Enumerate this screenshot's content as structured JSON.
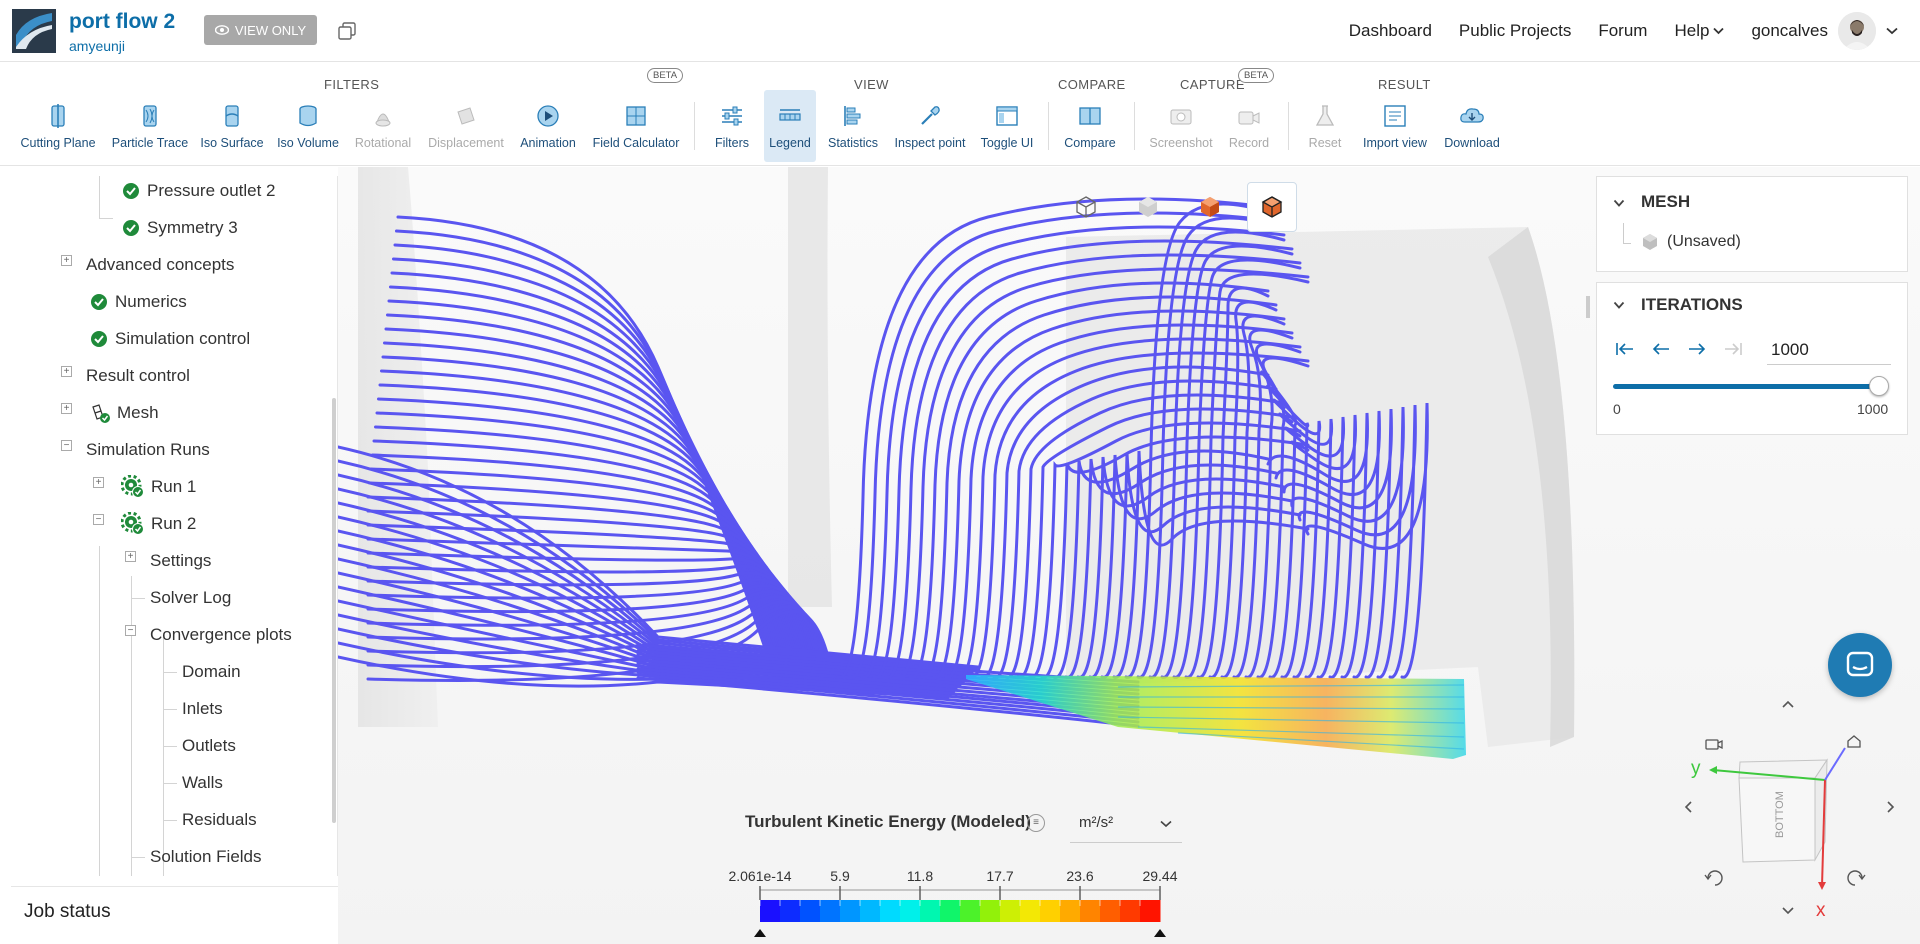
{
  "header": {
    "project_title": "port flow 2",
    "project_owner": "amyeunji",
    "view_only_label": "VIEW ONLY",
    "nav": {
      "dashboard": "Dashboard",
      "public_projects": "Public Projects",
      "forum": "Forum",
      "help": "Help",
      "username": "goncalves"
    }
  },
  "toolbar": {
    "groups": {
      "filters": "FILTERS",
      "view": "VIEW",
      "compare": "COMPARE",
      "capture": "CAPTURE",
      "result": "RESULT"
    },
    "beta_label": "BETA",
    "tools": {
      "cutting_plane": "Cutting Plane",
      "particle_trace": "Particle Trace",
      "iso_surface": "Iso Surface",
      "iso_volume": "Iso Volume",
      "rotational": "Rotational",
      "displacement": "Displacement",
      "animation": "Animation",
      "field_calculator": "Field Calculator",
      "filters": "Filters",
      "legend": "Legend",
      "statistics": "Statistics",
      "inspect_point": "Inspect point",
      "toggle_ui": "Toggle UI",
      "compare": "Compare",
      "screenshot": "Screenshot",
      "record": "Record",
      "reset": "Reset",
      "import_view": "Import view",
      "download": "Download"
    }
  },
  "tree": {
    "pressure_outlet_2": "Pressure outlet 2",
    "symmetry_3": "Symmetry 3",
    "advanced_concepts": "Advanced concepts",
    "numerics": "Numerics",
    "simulation_control": "Simulation control",
    "result_control": "Result control",
    "mesh": "Mesh",
    "simulation_runs": "Simulation Runs",
    "run_1": "Run 1",
    "run_2": "Run 2",
    "settings": "Settings",
    "solver_log": "Solver Log",
    "convergence_plots": "Convergence plots",
    "domain": "Domain",
    "inlets": "Inlets",
    "outlets": "Outlets",
    "walls": "Walls",
    "residuals": "Residuals",
    "solution_fields": "Solution Fields"
  },
  "job_status": "Job status",
  "panels": {
    "mesh": {
      "title": "MESH",
      "item": "(Unsaved)"
    },
    "iterations": {
      "title": "ITERATIONS",
      "value": "1000",
      "min_label": "0",
      "max_label": "1000",
      "slider_fraction": 1.0
    }
  },
  "legend": {
    "title": "Turbulent Kinetic Energy (Modeled)",
    "unit": "m²/s²",
    "tick_labels": [
      "2.061e-14",
      "5.9",
      "11.8",
      "17.7",
      "23.6",
      "29.44"
    ],
    "colors": [
      "#1a10ff",
      "#0d2cff",
      "#0052ff",
      "#0074ff",
      "#0096ff",
      "#00b8ff",
      "#00daff",
      "#00f0ea",
      "#00f7b0",
      "#10f56a",
      "#4cf22a",
      "#92f10a",
      "#cdef05",
      "#f3e805",
      "#ffd000",
      "#ffaa00",
      "#ff8400",
      "#ff5e00",
      "#ff3a00",
      "#ff1400"
    ]
  },
  "gizmo": {
    "face_label": "BOTTOM",
    "axis_y": "y",
    "axis_x": "x",
    "y_color": "#3ec83e",
    "x_color": "#e33b3b",
    "z_color": "#6b6bff"
  },
  "colors": {
    "accent": "#0d6ea8",
    "streamline": "#5a55f0",
    "check": "#1f8a3a"
  }
}
